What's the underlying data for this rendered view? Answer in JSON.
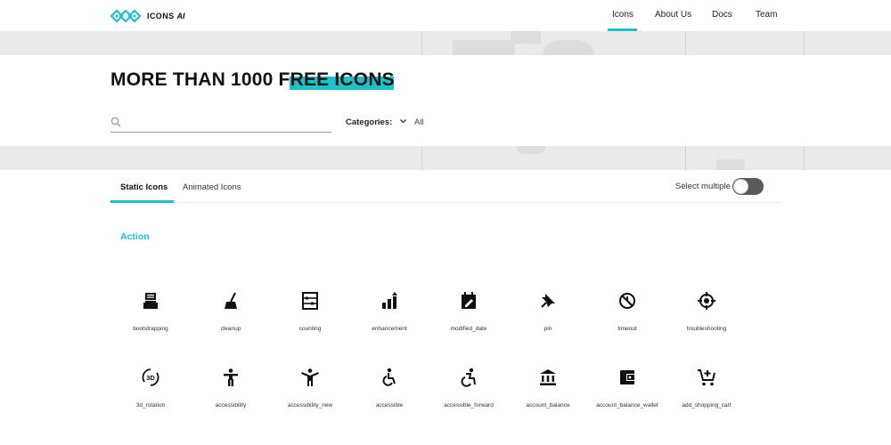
{
  "nav": {
    "logo_text": "ICONS",
    "logo_suffix": "AI",
    "links": [
      {
        "label": "Icons",
        "active": true
      },
      {
        "label": "About Us",
        "active": false
      },
      {
        "label": "Docs",
        "active": false
      },
      {
        "label": "Team",
        "active": false
      }
    ]
  },
  "hero": {
    "headline": "MORE THAN 1000 FREE ICONS",
    "search_placeholder": "",
    "search_value": "",
    "categories_label": "Categories:",
    "categories_value": "All"
  },
  "tabs": [
    {
      "label": "Static Icons",
      "active": true
    },
    {
      "label": "Animated Icons",
      "active": false
    }
  ],
  "select_multiple": {
    "label": "Select multiple",
    "enabled": false
  },
  "section": {
    "title": "Action",
    "icons": [
      {
        "name": "bootstrapping",
        "icon": "bootstrapping-icon"
      },
      {
        "name": "cleanup",
        "icon": "cleanup-icon"
      },
      {
        "name": "counting",
        "icon": "counting-icon"
      },
      {
        "name": "enhancement",
        "icon": "enhancement-icon"
      },
      {
        "name": "modified_date",
        "icon": "modified-date-icon"
      },
      {
        "name": "pin",
        "icon": "pin-icon"
      },
      {
        "name": "timeout",
        "icon": "timeout-icon"
      },
      {
        "name": "troubleshooting",
        "icon": "troubleshooting-icon"
      },
      {
        "name": "3d_rotation",
        "icon": "3d-rotation-icon"
      },
      {
        "name": "accessibility",
        "icon": "accessibility-icon"
      },
      {
        "name": "accessibility_new",
        "icon": "accessibility-new-icon"
      },
      {
        "name": "accessible",
        "icon": "accessible-icon"
      },
      {
        "name": "accessible_forward",
        "icon": "accessible-forward-icon"
      },
      {
        "name": "account_balance",
        "icon": "account-balance-icon"
      },
      {
        "name": "account_balance_wallet",
        "icon": "account-balance-wallet-icon"
      },
      {
        "name": "add_shopping_cart",
        "icon": "add-shopping-cart-icon"
      }
    ]
  },
  "colors": {
    "accent": "#1bc2c8",
    "hero_band": "#e9eaeb",
    "toggle_off": "#5a5a5a"
  }
}
